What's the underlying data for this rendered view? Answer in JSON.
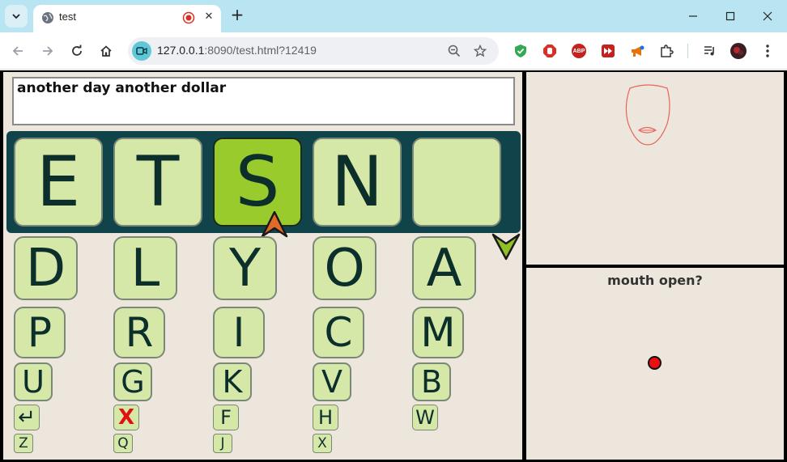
{
  "browser": {
    "tab_title": "test",
    "url_host": "127.0.0.1",
    "url_rest": ":8090/test.html?12419",
    "new_tab_label": "+",
    "close_tab_label": "✕"
  },
  "app": {
    "typed_text": "another day another dollar",
    "top_row_keys": [
      "E",
      "T",
      "S",
      "N",
      ""
    ],
    "selected_key": "S",
    "grid_rows": [
      [
        "D",
        "L",
        "Y",
        "O",
        "A"
      ],
      [
        "P",
        "R",
        "I",
        "C",
        "M"
      ],
      [
        "U",
        "G",
        "K",
        "V",
        "B"
      ],
      [
        "↵",
        "X",
        "F",
        "H",
        "W"
      ],
      [
        "Z",
        "Q",
        "J",
        "X"
      ]
    ],
    "mouth_question": "mouth open?",
    "colors": {
      "key_fill": "#d6e8a8",
      "key_selected": "#9acb2c",
      "top_row_bg": "#10444a",
      "panel_bg": "#ede6dd",
      "cursor_orange": "#e06a2a",
      "check_green": "#8fc026",
      "indicator_red": "#ee1010"
    }
  }
}
